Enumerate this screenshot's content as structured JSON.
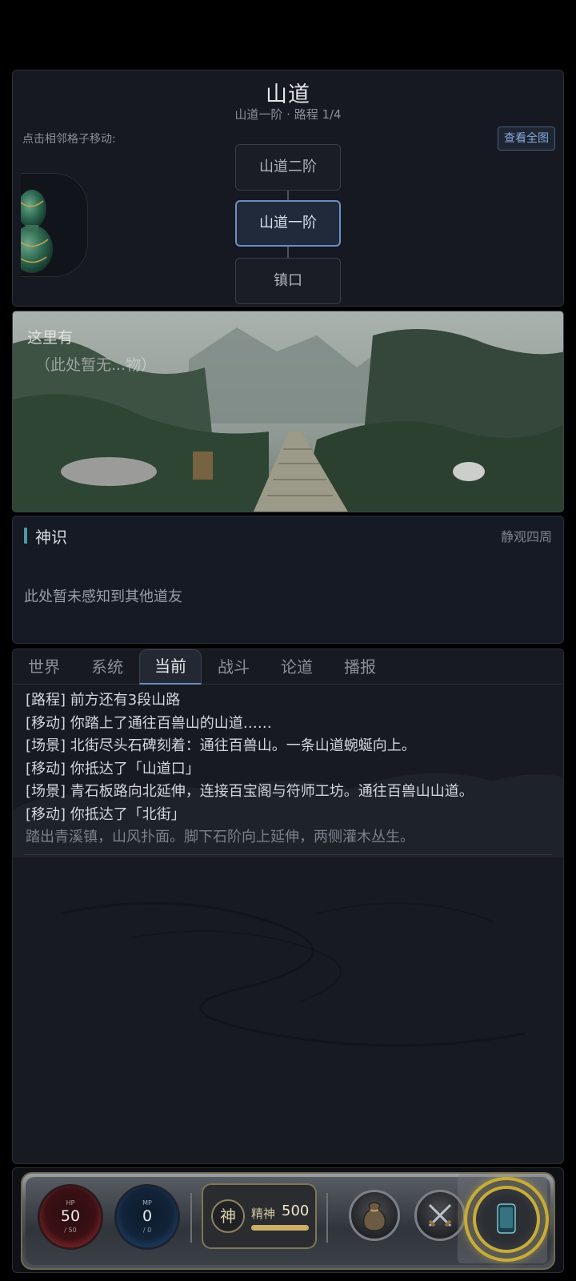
{
  "map": {
    "title": "山道",
    "subtitle": "山道一阶 · 路程 1/4",
    "hint": "点击相邻格子移动:",
    "view_full_map": "查看全图",
    "nodes": [
      "山道二阶",
      "山道一阶",
      "镇口"
    ],
    "current_node": "山道一阶"
  },
  "scene": {
    "overlay_title": "这里有",
    "overlay_note": "（此处暂无...物）"
  },
  "sense": {
    "title": "神识",
    "action": "静观四周",
    "message": "此处暂未感知到其他道友"
  },
  "log": {
    "tabs": [
      "世界",
      "系统",
      "当前",
      "战斗",
      "论道",
      "播报"
    ],
    "active_tab": "当前",
    "lines": [
      "[路程] 前方还有3段山路",
      "[移动] 你踏上了通往百兽山的山道……",
      "[场景] 北街尽头石碑刻着：通往百兽山。一条山道蜿蜒向上。",
      "[移动] 你抵达了「山道口」",
      "[场景] 青石板路向北延伸，连接百宝阁与符师工坊。通往百兽山山道。",
      "[移动] 你抵达了「北街」"
    ],
    "description": "踏出青溪镇，山风扑面。脚下石阶向上延伸，两侧灌木丛生。"
  },
  "hud": {
    "hp": {
      "label": "HP",
      "value": "50",
      "max": "/ 50"
    },
    "mp": {
      "label": "MP",
      "value": "0",
      "max": "/ 0"
    },
    "spirit": {
      "icon_char": "神",
      "label": "精神",
      "value": "500",
      "fill_fraction": 1.0
    },
    "buttons": [
      "bag-icon",
      "crossed-swords-icon",
      "phone-icon"
    ],
    "colors": {
      "hp": "#c22f36",
      "mp": "#254e7c",
      "accent_gold": "#c7ac3a",
      "accent_blue": "#6a8ec4"
    }
  }
}
